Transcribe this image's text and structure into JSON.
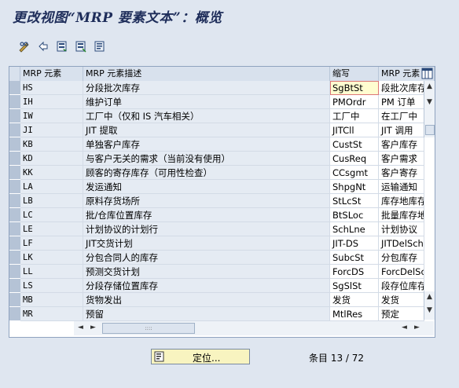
{
  "window": {
    "title": "更改视图“MRP 要素文本”：概览"
  },
  "toolbar": {
    "icons": [
      "pencil-glasses-icon",
      "undo-icon",
      "select-all-icon",
      "deselect-icon",
      "details-icon"
    ]
  },
  "table": {
    "headers": [
      "MRP 元素",
      "MRP 元素描述",
      "缩写",
      "MRP 元素"
    ],
    "rows": [
      [
        "HS",
        "分段批次库存",
        "SgBtSt",
        "段批次库存"
      ],
      [
        "IH",
        "维护订单",
        "PMOrdr",
        "PM 订单"
      ],
      [
        "IW",
        "工厂中（仅和 IS 汽车相关）",
        "工厂中",
        "在工厂中"
      ],
      [
        "JI",
        "JIT 提取",
        "JITCll",
        "JIT 调用"
      ],
      [
        "KB",
        "单独客户库存",
        "CustSt",
        "客户库存"
      ],
      [
        "KD",
        "与客户无关的需求（当前没有使用）",
        "CusReq",
        "客户需求"
      ],
      [
        "KK",
        "顾客的寄存库存（可用性检查）",
        "CCsgmt",
        "客户寄存"
      ],
      [
        "LA",
        "发运通知",
        "ShpgNt",
        "运输通知"
      ],
      [
        "LB",
        "原料存货场所",
        "StLcSt",
        "库存地库存"
      ],
      [
        "LC",
        "批/仓库位置库存",
        "BtSLoc",
        "批量库存地"
      ],
      [
        "LE",
        "计划协议的计划行",
        "SchLne",
        "计划协议"
      ],
      [
        "LF",
        "JIT交货计划",
        "JIT-DS",
        "JITDelSch"
      ],
      [
        "LK",
        "分包合同人的库存",
        "SubcSt",
        "分包库存"
      ],
      [
        "LL",
        "预测交货计划",
        "ForcDS",
        "ForcDelSch"
      ],
      [
        "LS",
        "分段存储位置库存",
        "SgSlSt",
        "段存位库存"
      ],
      [
        "MB",
        "货物发出",
        "发货",
        "发货"
      ],
      [
        "MR",
        "预留",
        "MtlRes",
        "预定"
      ]
    ]
  },
  "footer": {
    "locate_label": "定位...",
    "entry_label": "条目 13 / 72"
  }
}
